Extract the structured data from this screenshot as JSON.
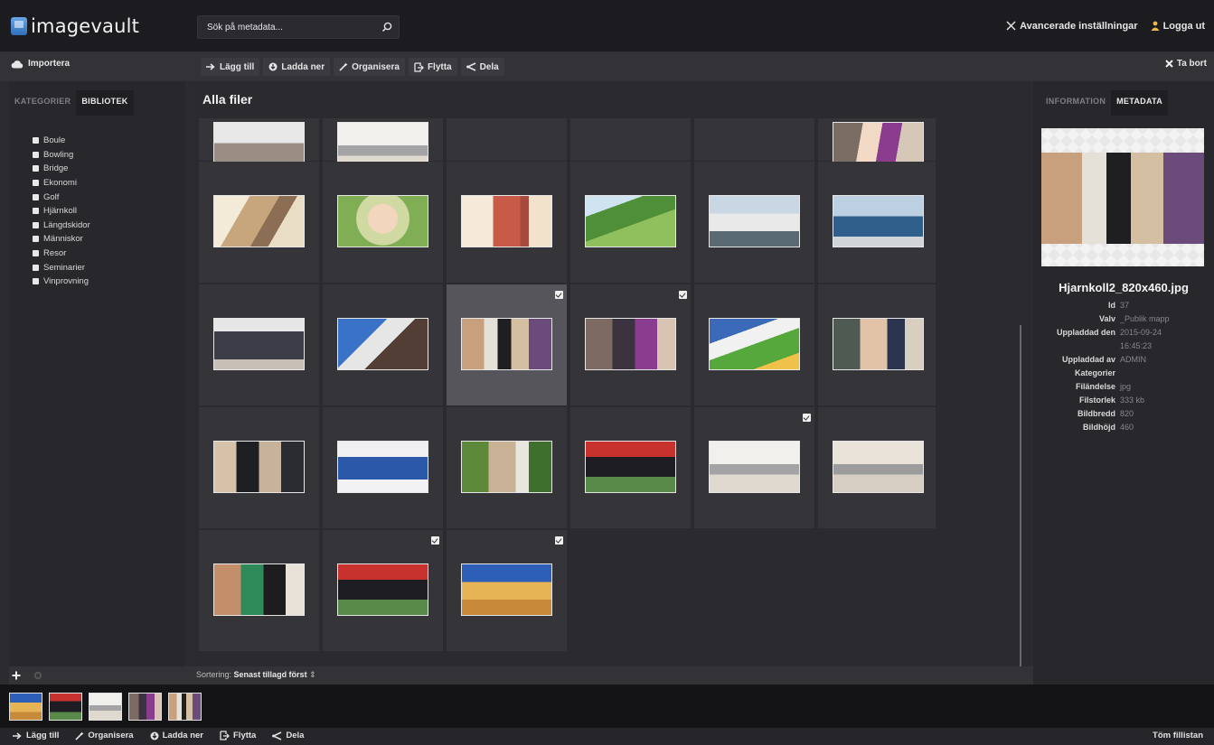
{
  "app": {
    "logo_text": "imagevault"
  },
  "search": {
    "placeholder": "Sök på metadata..."
  },
  "topbar": {
    "advanced_label": "Avancerade inställningar",
    "logout_label": "Logga ut"
  },
  "actionbar": {
    "import_label": "Importera",
    "actions": [
      {
        "label": "Lägg till",
        "icon": "arrow-right-icon"
      },
      {
        "label": "Ladda ner",
        "icon": "download-icon"
      },
      {
        "label": "Organisera",
        "icon": "wand-icon"
      },
      {
        "label": "Flytta",
        "icon": "move-icon"
      },
      {
        "label": "Dela",
        "icon": "share-icon"
      }
    ],
    "delete_label": "Ta bort"
  },
  "left": {
    "tabs": [
      {
        "label": "KATEGORIER",
        "active": false
      },
      {
        "label": "BIBLIOTEK",
        "active": true
      }
    ],
    "categories": [
      "Boule",
      "Bowling",
      "Bridge",
      "Ekonomi",
      "Golf",
      "Hjärnkoll",
      "Längdskidor",
      "Människor",
      "Resor",
      "Seminarier",
      "Vinprovning"
    ]
  },
  "main": {
    "title": "Alla filer",
    "tiles": [
      {
        "photo": "p-w",
        "checked": false,
        "selected": false
      },
      {
        "photo": "p-q",
        "checked": false,
        "selected": false
      },
      {
        "photo": "none",
        "checked": false,
        "selected": false
      },
      {
        "photo": "none",
        "checked": false,
        "selected": false
      },
      {
        "photo": "none",
        "checked": false,
        "selected": false
      },
      {
        "photo": "p-x",
        "checked": false,
        "selected": false
      },
      {
        "photo": "p-a",
        "checked": false,
        "selected": false
      },
      {
        "photo": "p-b",
        "checked": false,
        "selected": false
      },
      {
        "photo": "p-c",
        "checked": false,
        "selected": false
      },
      {
        "photo": "p-d",
        "checked": false,
        "selected": false
      },
      {
        "photo": "p-e",
        "checked": false,
        "selected": false
      },
      {
        "photo": "p-f",
        "checked": false,
        "selected": false
      },
      {
        "photo": "p-g",
        "checked": false,
        "selected": false
      },
      {
        "photo": "p-h",
        "checked": false,
        "selected": false
      },
      {
        "photo": "p-i",
        "checked": true,
        "selected": true
      },
      {
        "photo": "p-j",
        "checked": true,
        "selected": false
      },
      {
        "photo": "p-k",
        "checked": false,
        "selected": false
      },
      {
        "photo": "p-l",
        "checked": false,
        "selected": false
      },
      {
        "photo": "p-m",
        "checked": false,
        "selected": false
      },
      {
        "photo": "p-n",
        "checked": false,
        "selected": false
      },
      {
        "photo": "p-o",
        "checked": false,
        "selected": false
      },
      {
        "photo": "p-t",
        "checked": false,
        "selected": false
      },
      {
        "photo": "p-q",
        "checked": true,
        "selected": false
      },
      {
        "photo": "p-r",
        "checked": false,
        "selected": false
      },
      {
        "photo": "p-s",
        "checked": false,
        "selected": false
      },
      {
        "photo": "p-t",
        "checked": true,
        "selected": false
      },
      {
        "photo": "p-u",
        "checked": true,
        "selected": false
      }
    ]
  },
  "sort": {
    "label": "Sortering:",
    "value": "Senast tillagd först"
  },
  "right": {
    "tabs": [
      {
        "label": "INFORMATION",
        "active": false
      },
      {
        "label": "METADATA",
        "active": true
      }
    ],
    "filename": "Hjarnkoll2_820x460.jpg",
    "meta": [
      {
        "label": "Id",
        "value": "37"
      },
      {
        "label": "Valv",
        "value": "_Publik mapp"
      },
      {
        "label": "Uppladdad den",
        "value": "2015-09-24"
      },
      {
        "label": "",
        "value": "16:45:23"
      },
      {
        "label": "Uppladdad av",
        "value": "ADMIN"
      },
      {
        "label": "Kategorier",
        "value": ""
      },
      {
        "label": "Filändelse",
        "value": "jpg"
      },
      {
        "label": "Filstorlek",
        "value": "333 kb"
      },
      {
        "label": "Bildbredd",
        "value": "820"
      },
      {
        "label": "Bildhöjd",
        "value": "460"
      }
    ]
  },
  "basket": {
    "photos": [
      "p-u",
      "p-t",
      "p-q",
      "p-j",
      "p-i"
    ]
  },
  "bottombar": {
    "actions": [
      {
        "label": "Lägg till",
        "icon": "arrow-right-icon"
      },
      {
        "label": "Organisera",
        "icon": "wand-icon"
      },
      {
        "label": "Ladda ner",
        "icon": "download-icon"
      },
      {
        "label": "Flytta",
        "icon": "move-icon"
      },
      {
        "label": "Dela",
        "icon": "share-icon"
      }
    ],
    "empty_label": "Töm fillistan"
  }
}
